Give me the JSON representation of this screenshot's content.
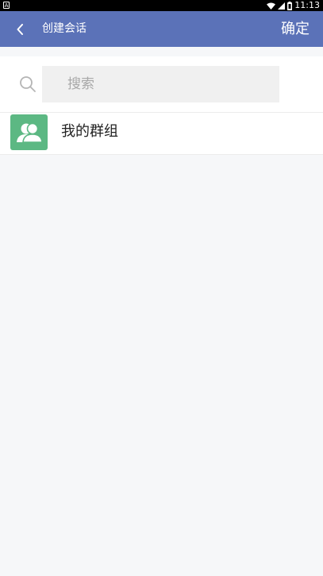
{
  "status_bar": {
    "left_icon_label": "A",
    "time": "11:13"
  },
  "header": {
    "back_icon": "chevron-left-icon",
    "title": "创建会话",
    "confirm_label": "确定",
    "background_color": "#5b72b8"
  },
  "search": {
    "icon": "search-icon",
    "placeholder": "搜索",
    "value": ""
  },
  "list": {
    "items": [
      {
        "icon": "group-users-icon",
        "label": "我的群组",
        "icon_color": "#5cb883"
      }
    ]
  }
}
